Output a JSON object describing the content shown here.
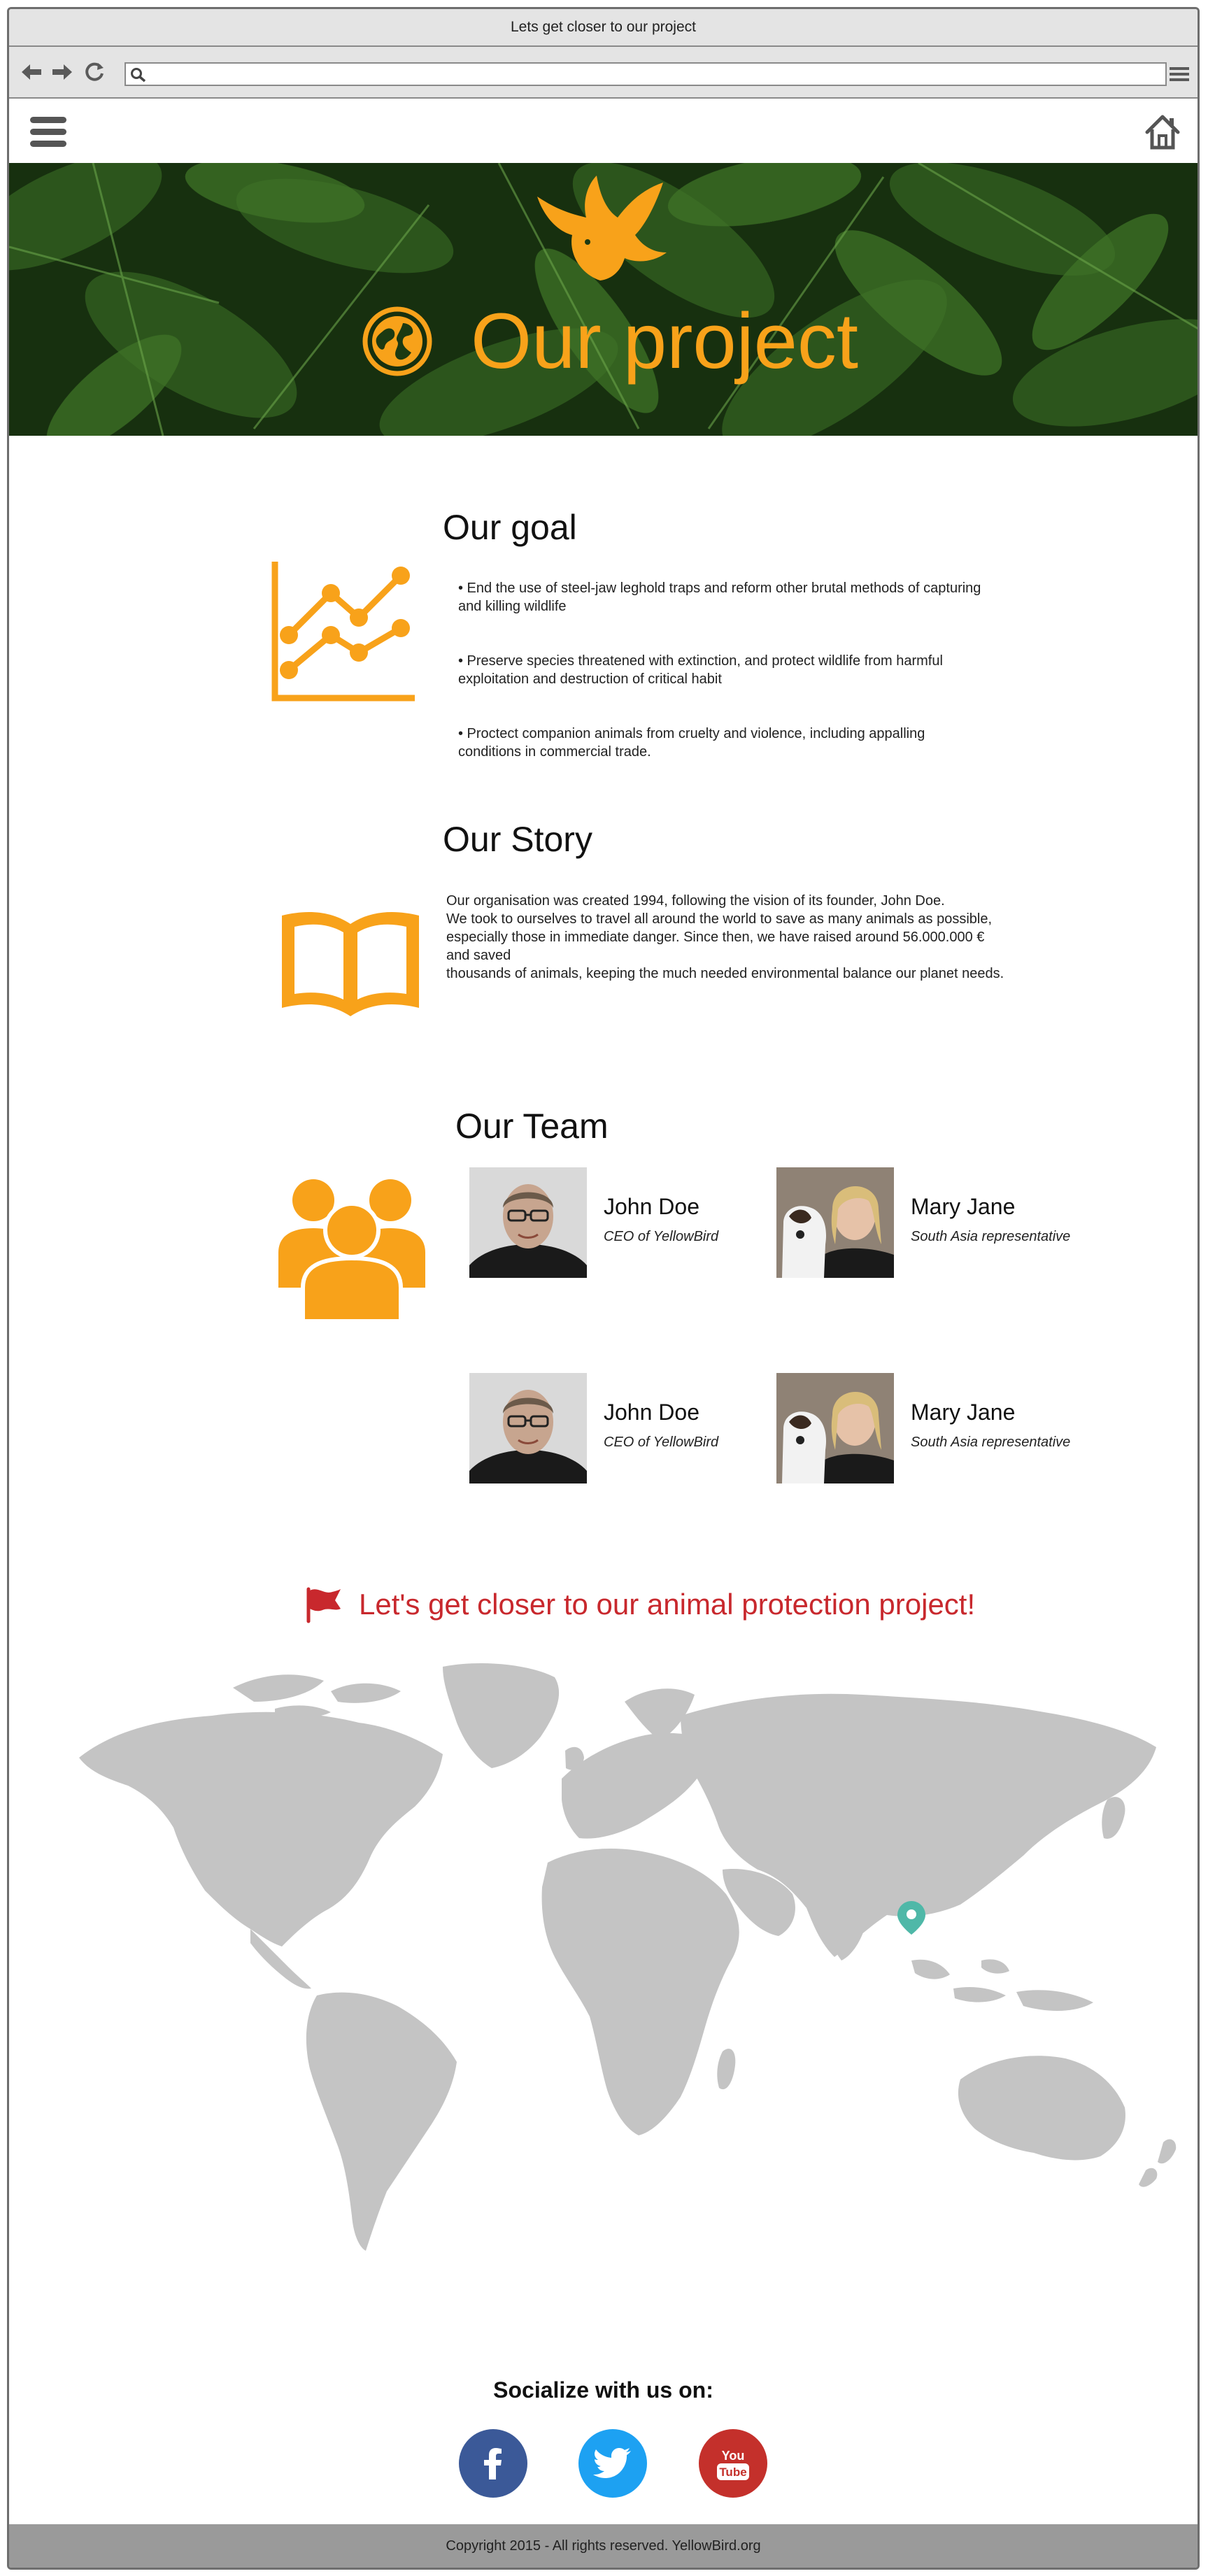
{
  "browser": {
    "window_title": "Lets get closer to our project",
    "url_value": "",
    "url_placeholder": ""
  },
  "hero": {
    "title": "Our project",
    "accent_color": "#f8a21a"
  },
  "goal": {
    "heading": "Our goal",
    "items": [
      "•    End the use of steel-jaw leghold traps and reform other brutal methods of capturing and killing wildlife",
      "•    Preserve species threatened with extinction, and protect wildlife from harmful exploitation and destruction of critical habit",
      "•    Proctect companion animals from cruelty and violence, including appalling conditions in commercial trade."
    ]
  },
  "story": {
    "heading": "Our Story",
    "lines": [
      "Our organisation was created 1994, following the vision of its founder, John Doe.",
      "We took to ourselves to travel all around the world to save as many animals as possible,",
      "especially those in immediate danger. Since then, we have raised around 56.000.000 € and saved",
      "thousands of animals, keeping the much needed environmental balance our planet needs."
    ]
  },
  "team": {
    "heading": "Our Team",
    "members": [
      {
        "name": "John Doe",
        "role": "CEO of YellowBird"
      },
      {
        "name": "Mary Jane",
        "role": "South Asia representative"
      },
      {
        "name": "John Doe",
        "role": "CEO of YellowBird"
      },
      {
        "name": "Mary Jane",
        "role": "South Asia representative"
      }
    ]
  },
  "cta": {
    "text": "Let's get closer to our animal protection project!",
    "color": "#c8282d"
  },
  "map": {
    "land_color": "#c4c4c4",
    "marker_color": "#4fb8a8"
  },
  "social": {
    "title": "Socialize with us on:",
    "facebook_color": "#3b5998",
    "twitter_color": "#1da1f2",
    "youtube_color": "#c4302b",
    "youtube_you": "You",
    "youtube_tube": "Tube"
  },
  "footer": {
    "text": "Copyright 2015  - All rights reserved. YellowBird.org"
  }
}
